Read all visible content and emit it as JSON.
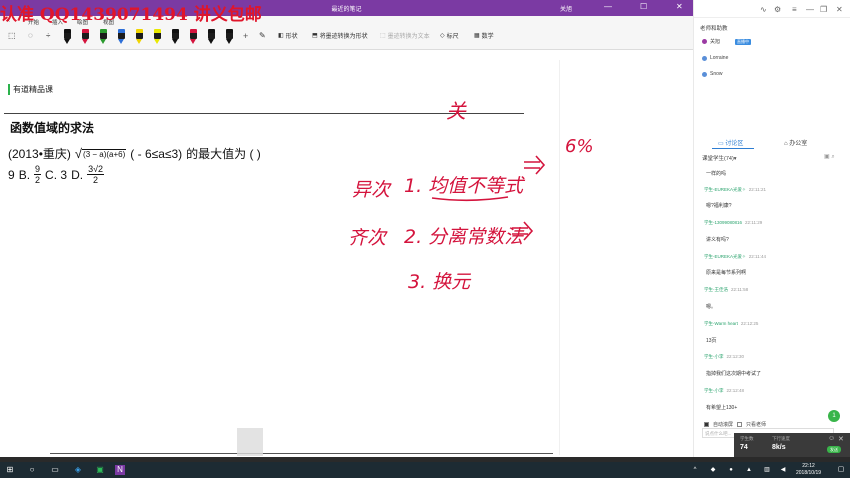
{
  "watermark": "认准 QQ1439071494 讲义包邮",
  "window": {
    "title": "最近的笔记",
    "user": "关旭",
    "controls": {
      "min": "—",
      "max": "☐",
      "close": "✕"
    }
  },
  "menu_tabs": [
    "开始",
    "插入",
    "绘图",
    "视图"
  ],
  "ribbon": {
    "shapes_label": "形状",
    "ink_to_shape_label": "将墨迹转换为形状",
    "ink_to_text_label": "墨迹转换为文本",
    "ruler_label": "标尺",
    "math_label": "数学",
    "share_label": "共享"
  },
  "pen_colors": [
    "#111111",
    "#d4143d",
    "#2b9a2e",
    "#2d6fd8",
    "#f0d400",
    "#e8e800",
    "#111111",
    "#d4143d",
    "#111111",
    "#111111"
  ],
  "note": {
    "heading": "有道精品课",
    "topic": "函数值域的求法",
    "problem_prefix": "(2013•重庆)",
    "radical": "(3 − a)(a+6)",
    "problem_range": "( - 6≤a≤3)",
    "problem_suffix": "的最大值为 (      )",
    "options": {
      "a_value": "9",
      "b_label": "B.",
      "b_num": "9",
      "b_den": "2",
      "c_label": "C. 3",
      "d_label": "D.",
      "d_num": "3√2",
      "d_den": "2"
    }
  },
  "panel": {
    "teacher_header": "老师和助教",
    "teachers": [
      {
        "name": "关旭",
        "badge": "直播中"
      },
      {
        "name": "Lorraine",
        "badge": ""
      },
      {
        "name": "Snow",
        "badge": ""
      }
    ],
    "tab_discussion": "讨论区",
    "tab_office": "办公室",
    "filter_label": "课堂学生(74)▾",
    "messages": [
      {
        "name": "",
        "time": "",
        "text": "一样的吗"
      },
      {
        "name": "学生-EUREKA光爱✧",
        "time": "22:11:21",
        "text": "嗯?福利康?"
      },
      {
        "name": "学生-13099080816",
        "time": "22:11:29",
        "text": "讲义有吗?"
      },
      {
        "name": "学生-EUREKA光爱✧",
        "time": "22:11:44",
        "text": "原来是每节系列啊"
      },
      {
        "name": "学生-王佳浩",
        "time": "22:11:58",
        "text": "嗯。"
      },
      {
        "name": "学生-Warm heart",
        "time": "22:12:25",
        "text": "13页"
      },
      {
        "name": "学生-小李",
        "time": "22:12:30",
        "text": "指掉我们这次期中考试了"
      },
      {
        "name": "学生-小李",
        "time": "22:12:48",
        "text": "有希望上130+"
      }
    ],
    "notify_count": "1",
    "option_auto_scroll": "自动滚屏",
    "option_teacher_only": "只看老师",
    "input_placeholder": "说点什么吧...",
    "stats": {
      "students_label": "学生数",
      "students_value": "74",
      "speed_label": "下行速度",
      "speed_value": "8k/s",
      "send_label": "发送"
    }
  },
  "taskbar": {
    "time": "22:12",
    "date": "2018/10/19"
  },
  "handwriting": {
    "t1": "关",
    "t2": "6%",
    "t3": "异次",
    "t4": "1. 均值不等式",
    "t5": "齐次",
    "t6": "2. 分离常数法",
    "t7": "3. 换元"
  },
  "colors": {
    "accent_purple": "#7b3aa3",
    "ink_red": "#d4143d",
    "watermark_red": "#e0152a",
    "chat_green": "#2aa36d",
    "taskbar": "#1d2b33"
  }
}
